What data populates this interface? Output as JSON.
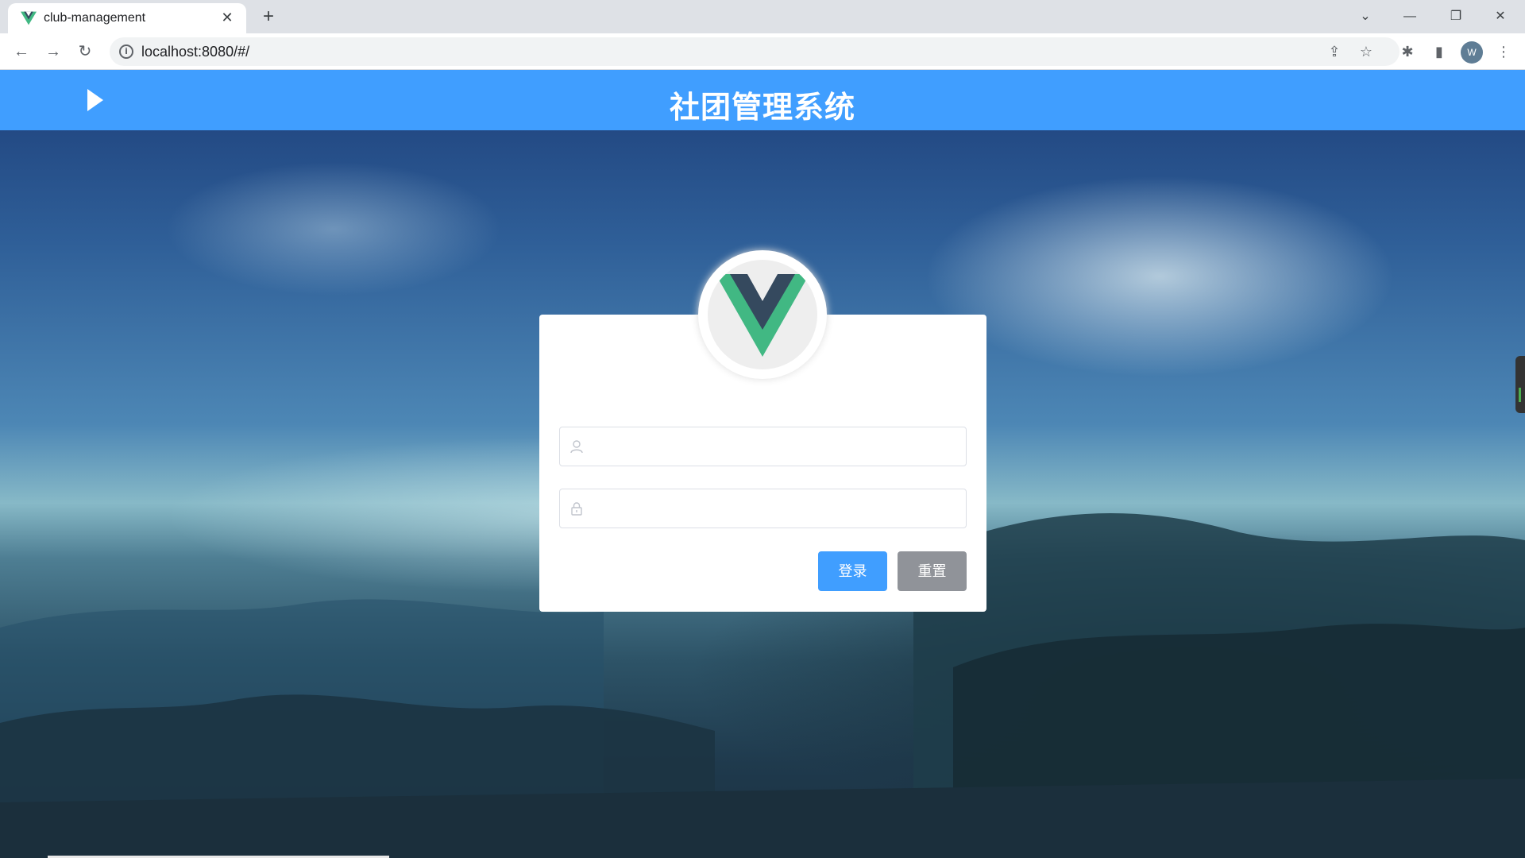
{
  "browser": {
    "tab_title": "club-management",
    "url": "localhost:8080/#/",
    "profile_initial": "W"
  },
  "header": {
    "title": "社团管理系统"
  },
  "login": {
    "username_placeholder": "",
    "password_placeholder": "",
    "login_label": "登录",
    "reset_label": "重置"
  },
  "colors": {
    "header": "#409eff",
    "primary_button": "#409eff",
    "reset_button": "#909399",
    "vue_green": "#41b883",
    "vue_dark": "#35495e"
  }
}
